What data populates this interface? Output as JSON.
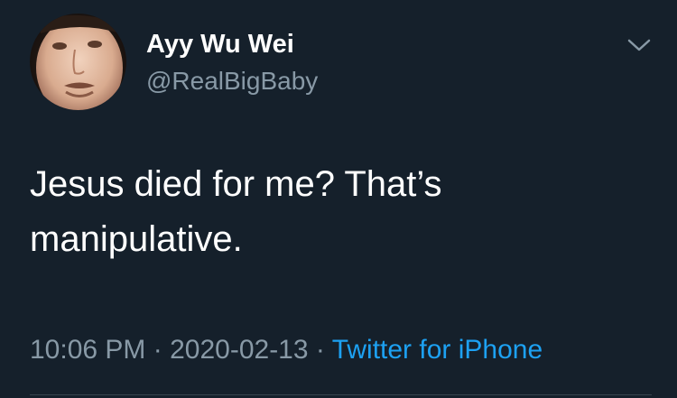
{
  "tweet": {
    "author": {
      "name": "Ayy Wu Wei",
      "handle": "@RealBigBaby"
    },
    "text": "Jesus died for me? That’s manipulative.",
    "time": "10:06 PM",
    "date": "2020-02-13",
    "separator": " · ",
    "source": "Twitter for iPhone"
  },
  "colors": {
    "background": "#15202b",
    "primary_text": "#ffffff",
    "secondary_text": "#8899a6",
    "link": "#1da1f2"
  },
  "icons": {
    "menu": "chevron-down-icon"
  }
}
